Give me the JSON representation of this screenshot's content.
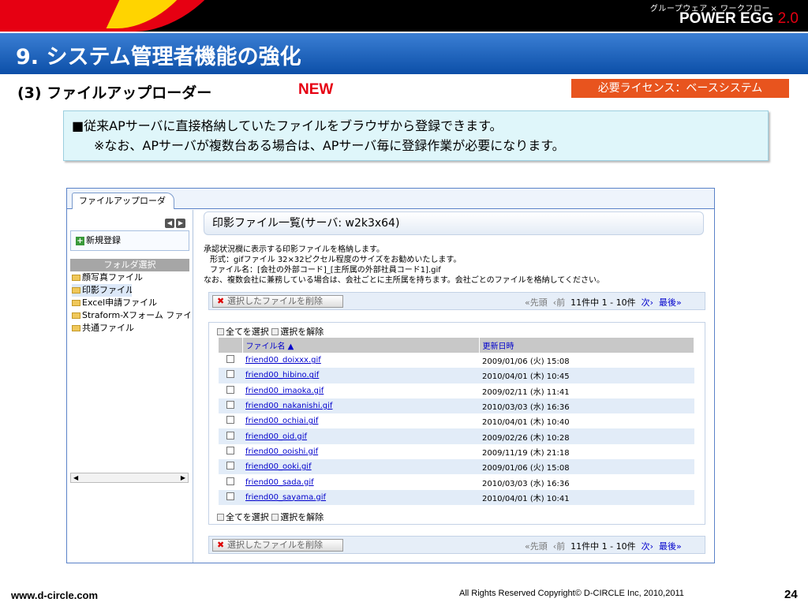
{
  "brand": {
    "sub": "グループウェア × ワークフロー",
    "name": "POWER EGG",
    "version": "2.0"
  },
  "title": "9. システム管理者機能の強化",
  "subtitle": "(3) ファイルアップローダー",
  "new_tag": "NEW",
  "license": "必要ライセンス：ベースシステム",
  "notes": {
    "line1": "■従来APサーバに直接格納していたファイルをブラウザから登録できます。",
    "line2": "※なお、APサーバが複数台ある場合は、APサーバ毎に登録作業が必要になります。"
  },
  "app": {
    "tab": "ファイルアップローダー",
    "new_button": "新規登録",
    "folder_header": "フォルダ選択",
    "folders": [
      "顔写真ファイル",
      "印影ファイル",
      "Excel申請ファイル",
      "Straform-Xフォーム ファイル",
      "共通ファイル"
    ],
    "panel_title": "印影ファイル一覧(サーバ: w2k3x64)",
    "desc": [
      "承認状況欄に表示する印影ファイルを格納します。",
      "形式：gifファイル 32×32ピクセル程度のサイズをお勧めいたします。",
      "ファイル名：[会社の外部コード]_[主所属の外部社員コード1].gif",
      "なお、複数会社に兼務している場合は、会社ごとに主所属を持ちます。会社ごとのファイルを格納してください。"
    ],
    "delete_button": "選択したファイルを削除",
    "pager": {
      "first": "«先頭",
      "prev": "‹前",
      "range": "11件中 1 - 10件",
      "next": "次›",
      "last": "最後»"
    },
    "select_all": "全てを選択",
    "deselect": "選択を解除",
    "columns": [
      "ファイル名 ▲",
      "更新日時"
    ],
    "rows": [
      {
        "name": "friend00_doixxx.gif",
        "date": "2009/01/06 (火) 15:08"
      },
      {
        "name": "friend00_hibino.gif",
        "date": "2010/04/01 (木) 10:45"
      },
      {
        "name": "friend00_imaoka.gif",
        "date": "2009/02/11 (水) 11:41"
      },
      {
        "name": "friend00_nakanishi.gif",
        "date": "2010/03/03 (水) 16:36"
      },
      {
        "name": "friend00_ochiai.gif",
        "date": "2010/04/01 (木) 10:40"
      },
      {
        "name": "friend00_oid.gif",
        "date": "2009/02/26 (木) 10:28"
      },
      {
        "name": "friend00_ooishi.gif",
        "date": "2009/11/19 (木) 21:18"
      },
      {
        "name": "friend00_ooki.gif",
        "date": "2009/01/06 (火) 15:08"
      },
      {
        "name": "friend00_sada.gif",
        "date": "2010/03/03 (水) 16:36"
      },
      {
        "name": "friend00_sayama.gif",
        "date": "2010/04/01 (木) 10:41"
      }
    ]
  },
  "footer": {
    "url": "www.d-circle.com",
    "copyright": "All Rights Reserved Copyright© D-CIRCLE Inc, 2010,2011",
    "page": "24"
  }
}
